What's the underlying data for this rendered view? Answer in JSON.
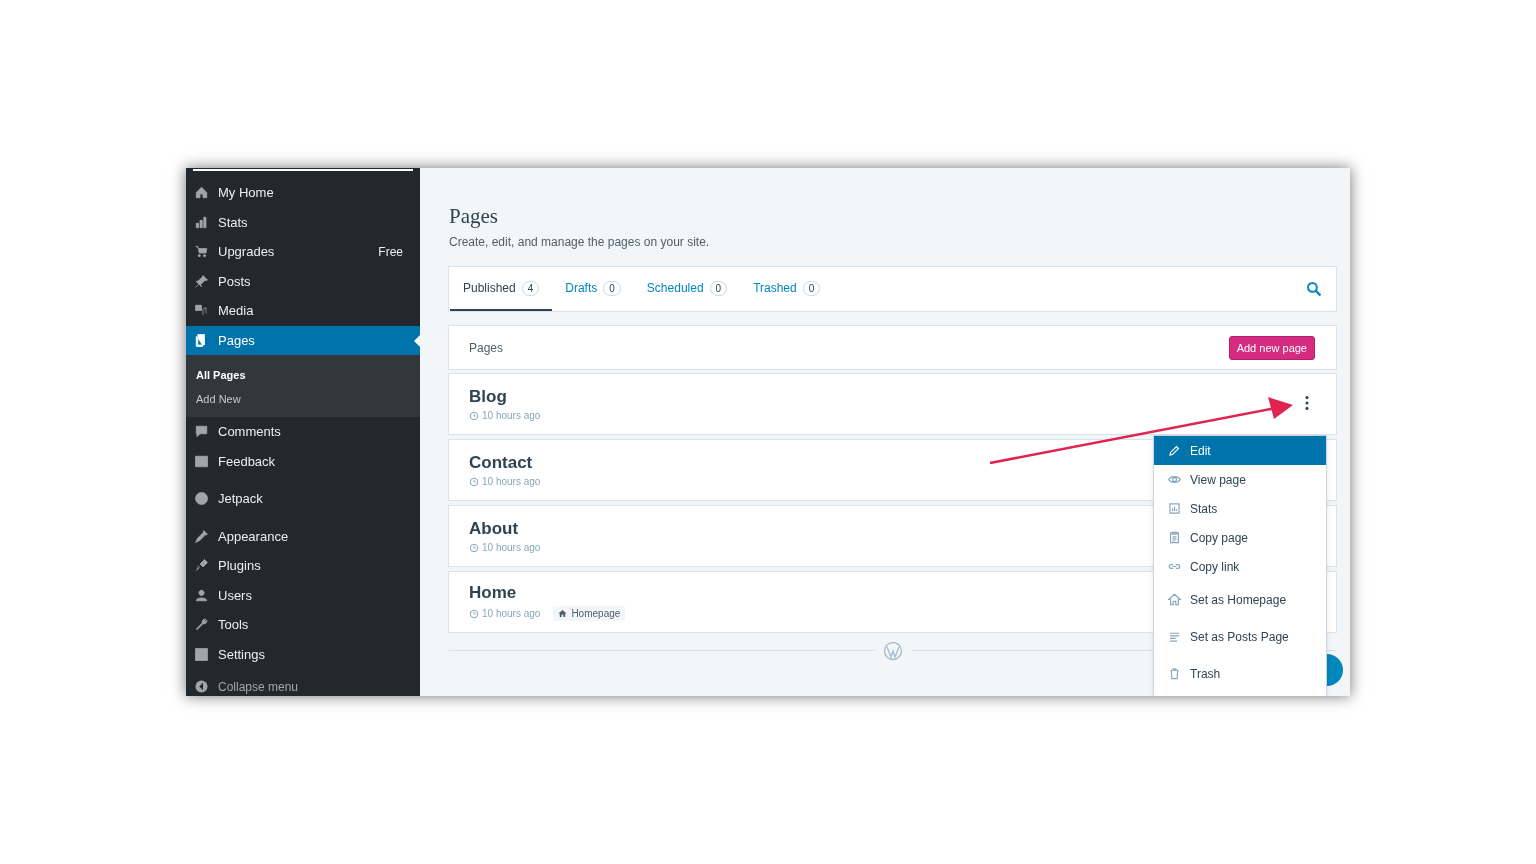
{
  "sidebar": {
    "groups": [
      [
        {
          "label": "My Home",
          "selected": false
        },
        {
          "label": "Stats",
          "selected": false
        },
        {
          "label": "Upgrades",
          "badge": "Free",
          "selected": false
        },
        {
          "label": "Posts",
          "selected": false
        },
        {
          "label": "Media",
          "selected": false
        },
        {
          "label": "Pages",
          "selected": true,
          "children": [
            {
              "label": "All Pages",
              "selected": true
            },
            {
              "label": "Add New",
              "selected": false
            }
          ]
        },
        {
          "label": "Comments",
          "selected": false
        },
        {
          "label": "Feedback",
          "selected": false
        }
      ],
      [
        {
          "label": "Jetpack",
          "selected": false
        }
      ],
      [
        {
          "label": "Appearance",
          "selected": false
        },
        {
          "label": "Plugins",
          "selected": false
        },
        {
          "label": "Users",
          "selected": false
        },
        {
          "label": "Tools",
          "selected": false
        },
        {
          "label": "Settings",
          "selected": false
        }
      ]
    ],
    "collapse": "Collapse menu"
  },
  "header": {
    "title": "Pages",
    "subtitle": "Create, edit, and manage the pages on your site."
  },
  "tabs": [
    {
      "label": "Published",
      "count": "4",
      "selected": true
    },
    {
      "label": "Drafts",
      "count": "0",
      "selected": false
    },
    {
      "label": "Scheduled",
      "count": "0",
      "selected": false
    },
    {
      "label": "Trashed",
      "count": "0",
      "selected": false
    }
  ],
  "list": {
    "heading": "Pages",
    "add_button": "Add new page",
    "rows": [
      {
        "title": "Blog",
        "time": "10 hours ago",
        "menu_open": true
      },
      {
        "title": "Contact",
        "time": "10 hours ago",
        "menu_open": false
      },
      {
        "title": "About",
        "time": "10 hours ago",
        "menu_open": false
      },
      {
        "title": "Home",
        "time": "10 hours ago",
        "badge": "Homepage",
        "menu_open": false
      }
    ]
  },
  "menu": {
    "groups": [
      [
        {
          "label": "Edit",
          "selected": true
        },
        {
          "label": "View page",
          "selected": false
        },
        {
          "label": "Stats",
          "selected": false
        },
        {
          "label": "Copy page",
          "selected": false
        },
        {
          "label": "Copy link",
          "selected": false
        }
      ],
      [
        {
          "label": "Set as Homepage",
          "selected": false
        },
        {
          "label": "Set as Posts Page",
          "selected": false
        },
        {
          "label": "Trash",
          "selected": false
        }
      ]
    ]
  }
}
